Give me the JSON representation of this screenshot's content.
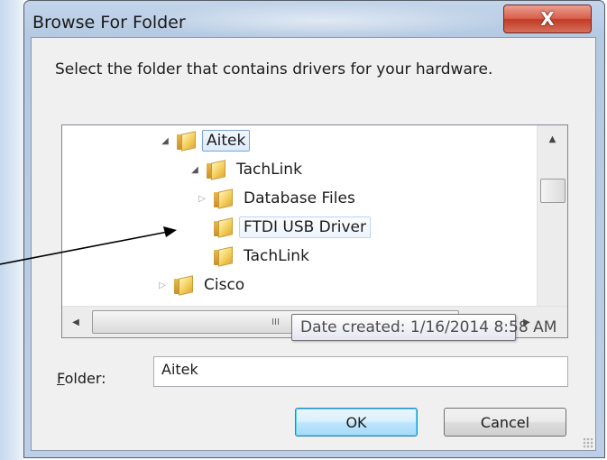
{
  "window": {
    "title": "Browse For Folder",
    "close_glyph": "X"
  },
  "dialog": {
    "description": "Select the folder that contains drivers for your hardware."
  },
  "tree": {
    "nodes": [
      {
        "label": "Aitek",
        "expander": "expanded",
        "level": 0,
        "selected": true
      },
      {
        "label": "TachLink",
        "expander": "expanded",
        "level": 1
      },
      {
        "label": "Database Files",
        "expander": "collapsed",
        "level": 2
      },
      {
        "label": "FTDI USB Driver",
        "expander": "none",
        "level": 2,
        "hovered": true
      },
      {
        "label": "TachLink",
        "expander": "none",
        "level": 2
      },
      {
        "label": "Cisco",
        "expander": "collapsed",
        "level": -1
      }
    ],
    "tooltip": "Date created: 1/16/2014 8:58 AM",
    "hscroll_thumb_glyph": "III"
  },
  "folder_field": {
    "label_prefix": "F",
    "label_rest": "older:",
    "value": "Aitek"
  },
  "buttons": {
    "ok": "OK",
    "cancel": "Cancel"
  },
  "icons": {
    "folder": "folder-icon",
    "expand": "triangle-expanded-icon",
    "collapse": "triangle-collapsed-icon"
  },
  "colors": {
    "title_bar": "#b4c9e2",
    "close_button": "#c23b25",
    "selection_border": "#7da2ce",
    "ok_default_border": "#3c7fb1"
  }
}
